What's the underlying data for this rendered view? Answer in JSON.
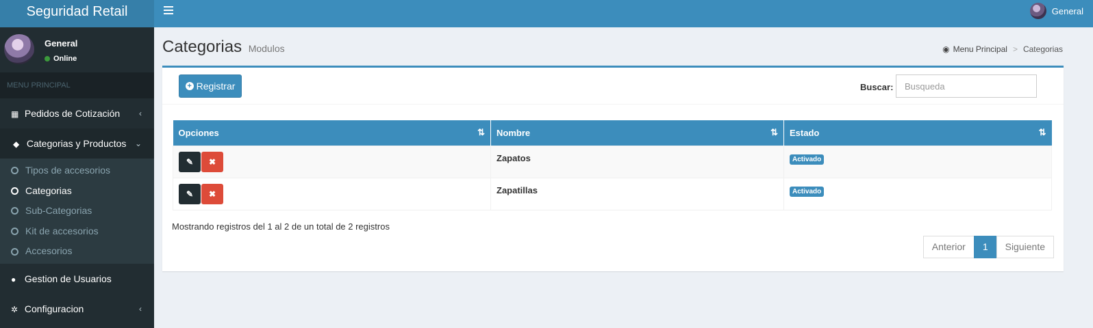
{
  "app": {
    "title": "Seguridad Retail"
  },
  "navbar": {
    "user_name": "General"
  },
  "sidebar": {
    "user": {
      "name": "General",
      "status": "Online"
    },
    "header": "MENU PRINCIPAL",
    "items": [
      {
        "label": "Pedidos de Cotización",
        "icon": "table-icon"
      },
      {
        "label": "Categorias y Productos",
        "icon": "cube-icon"
      },
      {
        "label": "Gestion de Usuarios",
        "icon": "user-icon"
      },
      {
        "label": "Configuracion",
        "icon": "gear-icon"
      }
    ],
    "subitems": [
      {
        "label": "Tipos de accesorios"
      },
      {
        "label": "Categorias"
      },
      {
        "label": "Sub-Categorias"
      },
      {
        "label": "Kit de accesorios"
      },
      {
        "label": "Accesorios"
      }
    ]
  },
  "content": {
    "title": "Categorias",
    "subtitle": "Modulos",
    "breadcrumb": {
      "home": "Menu Principal",
      "current": "Categorias"
    }
  },
  "toolbar": {
    "register_label": "Registrar",
    "search_label": "Buscar:",
    "search_placeholder": "Busqueda"
  },
  "table": {
    "columns": [
      "Opciones",
      "Nombre",
      "Estado"
    ],
    "rows": [
      {
        "nombre": "Zapatos",
        "estado": "Activado"
      },
      {
        "nombre": "Zapatillas",
        "estado": "Activado"
      }
    ]
  },
  "footer": {
    "info": "Mostrando registros del 1 al 2 de un total de 2 registros",
    "prev": "Anterior",
    "page": "1",
    "next": "Siguiente"
  },
  "colors": {
    "primary": "#3c8dbc",
    "sidebar": "#222d32",
    "danger": "#dd4b39"
  }
}
